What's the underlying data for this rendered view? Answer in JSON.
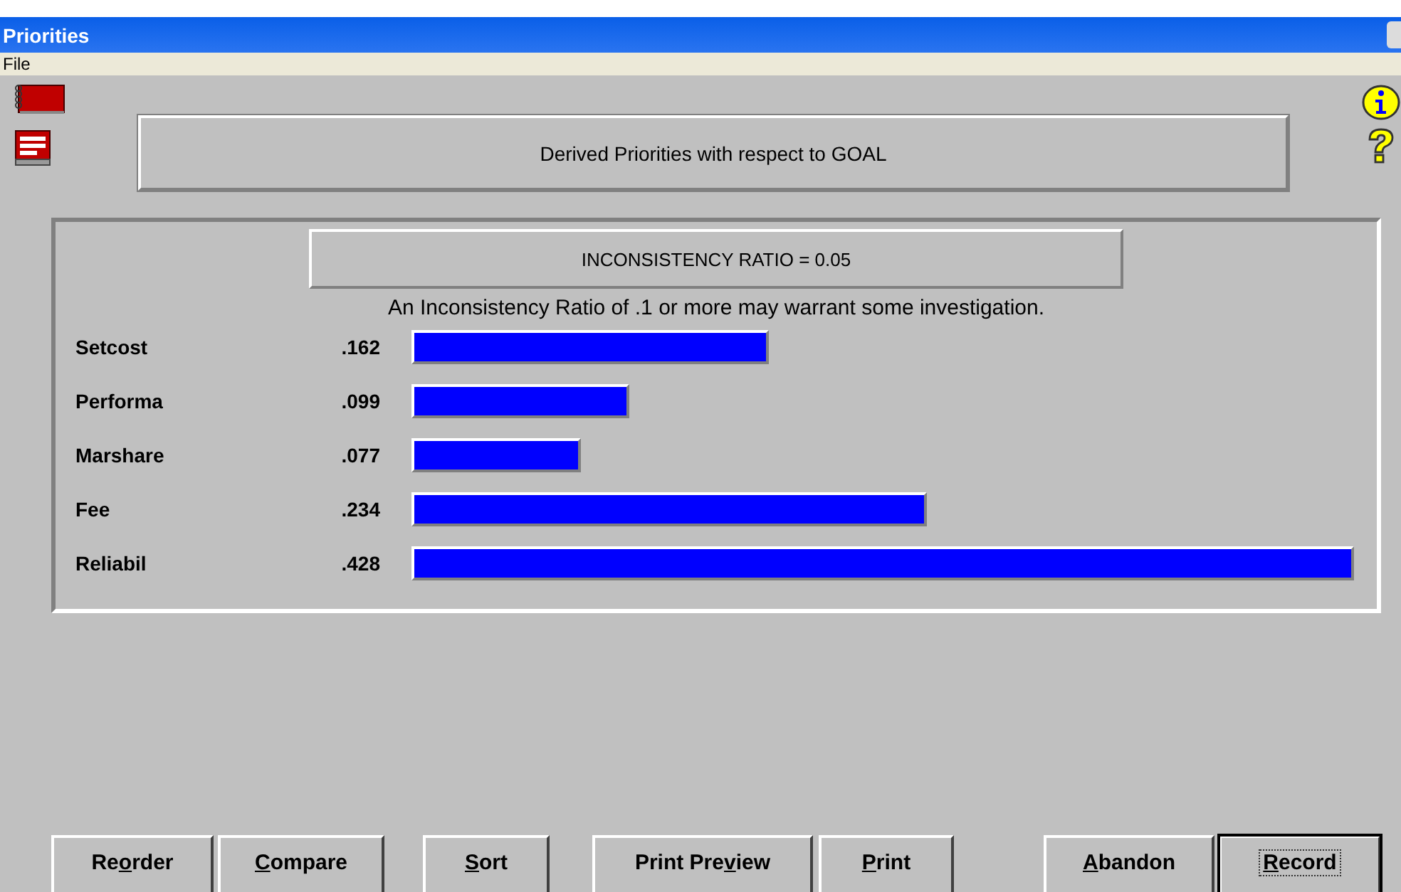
{
  "window": {
    "title": "Priorities"
  },
  "menu": [
    "File"
  ],
  "header": "Derived Priorities with respect to GOAL",
  "ratio": "INCONSISTENCY RATIO = 0.05",
  "note": "An Inconsistency Ratio of .1 or more may warrant some investigation.",
  "priorities": [
    {
      "name": "Setcost",
      "value": ".162"
    },
    {
      "name": "Performa",
      "value": ".099"
    },
    {
      "name": "Marshare",
      "value": ".077"
    },
    {
      "name": "Fee",
      "value": ".234"
    },
    {
      "name": "Reliabil",
      "value": ".428"
    }
  ],
  "buttons": [
    {
      "before": "Re",
      "key": "o",
      "after": "rder",
      "default": false
    },
    {
      "key": "C",
      "after": "ompare",
      "default": false
    },
    {
      "key": "S",
      "after": "ort",
      "default": false
    },
    {
      "before": "Print Pre",
      "key": "v",
      "after": "iew",
      "default": false
    },
    {
      "key": "P",
      "after": "rint",
      "default": false
    },
    {
      "key": "A",
      "after": "bandon",
      "default": false
    },
    {
      "key": "R",
      "after": "ecord",
      "default": true
    }
  ]
}
